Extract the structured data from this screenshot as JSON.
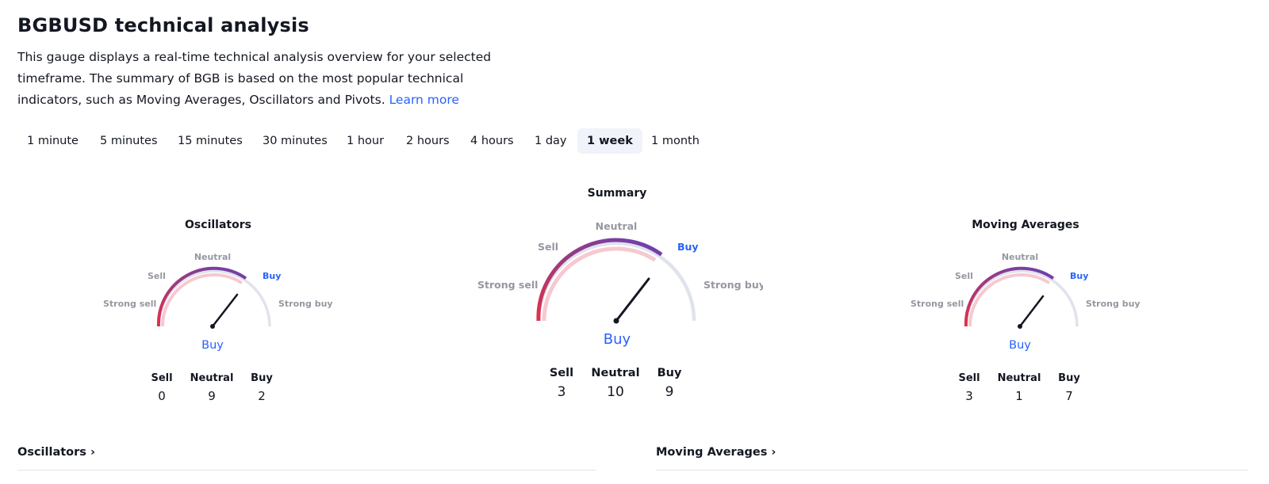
{
  "header": {
    "title": "BGBUSD technical analysis",
    "description": "This gauge displays a real-time technical analysis overview for your selected timeframe. The summary of BGB is based on the most popular technical indicators, such as Moving Averages, Oscillators and Pivots.",
    "learn_more": "Learn more"
  },
  "tabs": [
    "1 minute",
    "5 minutes",
    "15 minutes",
    "30 minutes",
    "1 hour",
    "2 hours",
    "4 hours",
    "1 day",
    "1 week",
    "1 month"
  ],
  "active_tab": "1 week",
  "labels": {
    "strong_sell": "Strong sell",
    "sell": "Sell",
    "neutral": "Neutral",
    "buy": "Buy",
    "strong_buy": "Strong buy"
  },
  "count_labels": {
    "sell": "Sell",
    "neutral": "Neutral",
    "buy": "Buy"
  },
  "gauges": {
    "oscillators": {
      "title": "Oscillators",
      "verdict": "Buy",
      "sell": "0",
      "neutral": "9",
      "buy": "2"
    },
    "summary": {
      "title": "Summary",
      "verdict": "Buy",
      "sell": "3",
      "neutral": "10",
      "buy": "9"
    },
    "moving_averages": {
      "title": "Moving Averages",
      "verdict": "Buy",
      "sell": "3",
      "neutral": "1",
      "buy": "7"
    }
  },
  "footer": {
    "oscillators_link": "Oscillators ›",
    "moving_averages_link": "Moving Averages ›"
  },
  "colors": {
    "accent": "#2962ff",
    "sell": "#e2304b",
    "neutral_arc": "#7b3fa8",
    "inactive_arc": "#e0e3eb",
    "active_tab_bg": "#f0f3fa"
  }
}
